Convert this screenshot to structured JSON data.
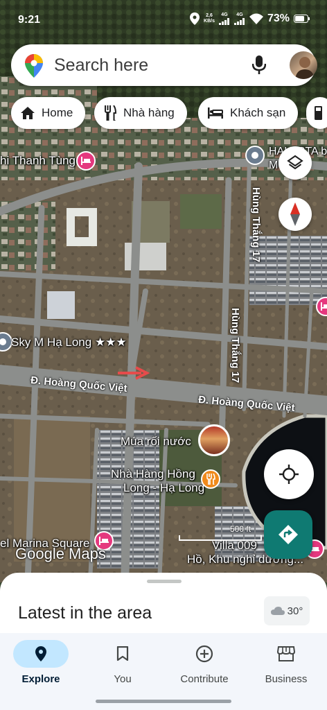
{
  "status_bar": {
    "time": "9:21",
    "data_rate_top": "2,6",
    "data_rate_unit": "KB/s",
    "net1": "4G",
    "net2": "4G",
    "battery": "73%"
  },
  "search": {
    "placeholder": "Search here",
    "icons": [
      "google-maps-pin-icon",
      "microphone-icon",
      "avatar"
    ]
  },
  "chips": [
    {
      "label": "Home",
      "icon": "home-icon"
    },
    {
      "label": "Nhà hàng",
      "icon": "restaurant-icon"
    },
    {
      "label": "Khách sạn",
      "icon": "hotel-icon"
    }
  ],
  "map": {
    "labels": {
      "thanh_tung": "hi Thanh Tùng",
      "halesta": "HALESTA by",
      "mon": "M    ON",
      "sky_m": "Sky M Hạ Long ★★★",
      "road_hqv_1": "Đ. Hoàng Quốc Việt",
      "road_hqv_2": "Đ. Hoàng Quốc Việt",
      "hung_thang_a": "Hùng Thắng 17",
      "hung_thang_b": "Hùng Thắng 17",
      "mua_roi": "Múa rối nước",
      "nha_hang_1": "Nhà Hàng Hồng",
      "nha_hang_2": "Long - Hạ Long",
      "marina": "el Marina Square",
      "villa": "Villa 009",
      "khu_nghi": "Hồ, Khu nghỉ dưỡng..."
    },
    "scale_label": "500 ft",
    "logo": "Google Maps"
  },
  "colors": {
    "accent": "#0b57d0",
    "active_nav_bg": "#c2e7ff",
    "directions_fab": "#0f7a72",
    "hotel_pin": "#e5387e",
    "food_pin": "#f08a1b"
  },
  "sheet": {
    "title": "Latest in the area",
    "weather": "30°"
  },
  "nav": [
    {
      "label": "Explore",
      "icon": "explore-pin-icon",
      "active": true
    },
    {
      "label": "You",
      "icon": "bookmark-icon",
      "active": false
    },
    {
      "label": "Contribute",
      "icon": "add-circle-icon",
      "active": false
    },
    {
      "label": "Business",
      "icon": "storefront-icon",
      "active": false
    }
  ]
}
